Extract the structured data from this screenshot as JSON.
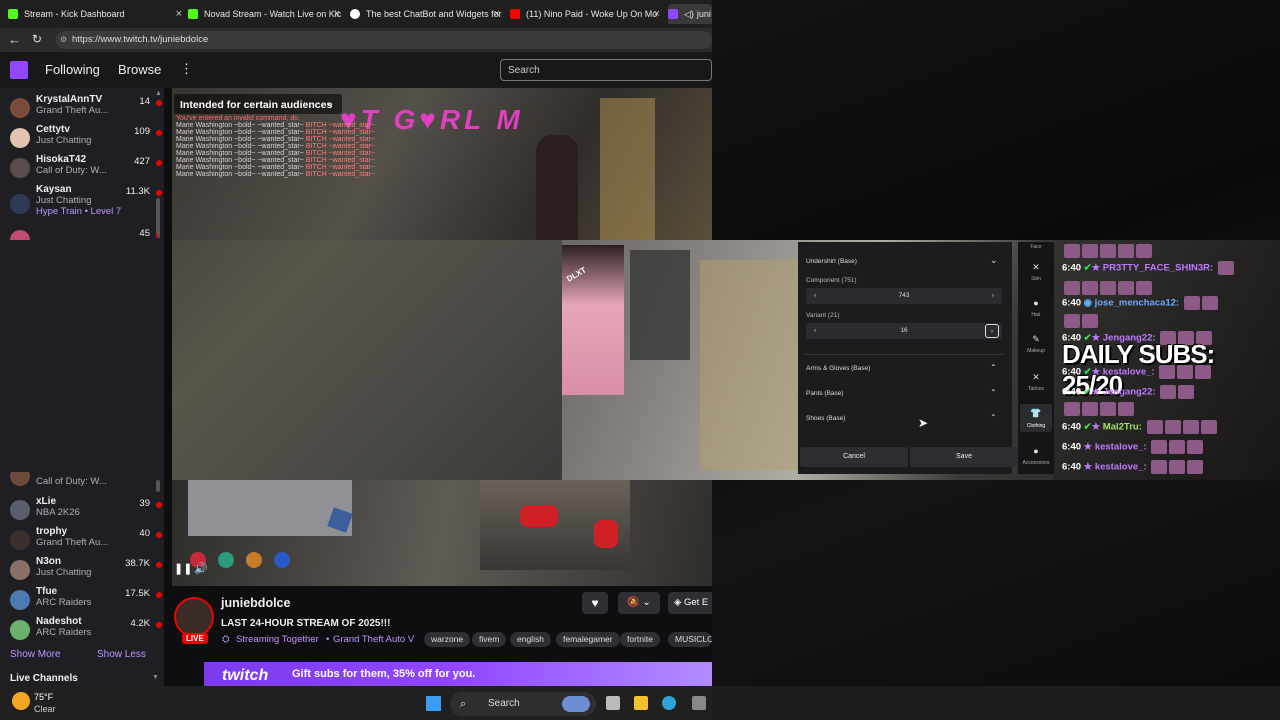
{
  "browser": {
    "tabs": [
      {
        "label": "Stream - Kick Dashboard",
        "color": "#53fc18"
      },
      {
        "label": "Novad Stream - Watch Live on Kic",
        "color": "#53fc18"
      },
      {
        "label": "The best ChatBot and Widgets for",
        "color": "#ffffff"
      },
      {
        "label": "(11) Nino Paid - Woke Up On Mo",
        "color": "#ff0000"
      },
      {
        "label": "juni",
        "color": "#9147ff"
      }
    ],
    "url": "https://www.twitch.tv/juniebdolce"
  },
  "twitch_nav": {
    "following": "Following",
    "browse": "Browse",
    "more": "⋮",
    "search_placeholder": "Search"
  },
  "sidebar": {
    "channels_top": [
      {
        "name": "KrystalAnnTV",
        "game": "Grand Theft Au...",
        "viewers": "14",
        "color": "#7a4a3a"
      },
      {
        "name": "Cettytv",
        "game": "Just Chatting",
        "viewers": "109",
        "color": "#e0c4b0"
      },
      {
        "name": "HisokaT42",
        "game": "Call of Duty: W...",
        "viewers": "427",
        "color": "#5a4c4a"
      },
      {
        "name": "Kaysan",
        "game": "Just Chatting",
        "viewers": "11.3K",
        "color": "#2e3b55",
        "extra": "Hype Train • Level 7"
      },
      {
        "name": "",
        "game": "",
        "viewers": "45",
        "color": "#c04a70"
      }
    ],
    "channels_bottom": [
      {
        "name": "",
        "game": "Call of Duty: W...",
        "viewers": "",
        "color": "#6a4a3a"
      },
      {
        "name": "xLie",
        "game": "NBA 2K26",
        "viewers": "39",
        "color": "#5a5f70"
      },
      {
        "name": "trophy",
        "game": "Grand Theft Au...",
        "viewers": "40",
        "color": "#3a2f2a"
      },
      {
        "name": "N3on",
        "game": "Just Chatting",
        "viewers": "38.7K",
        "color": "#8a7066"
      },
      {
        "name": "Tfue",
        "game": "ARC Raiders",
        "viewers": "17.5K",
        "color": "#4a7ab0"
      },
      {
        "name": "Nadeshot",
        "game": "ARC Raiders",
        "viewers": "4.2K",
        "color": "#6bb06b"
      }
    ],
    "show_more": "Show More",
    "show_less": "Show Less",
    "live_channels": "Live Channels"
  },
  "video": {
    "audience_label": "Intended for certain audiences",
    "stream_chat": {
      "notice": "You've entered an invalid command, do",
      "line_prefix": "Marie Washington ~bold~ ~wanted_star~",
      "line_suffix": "BITCH ~wanted_star~"
    }
  },
  "clothing_menu": {
    "undershirt": "Undershirt (Base)",
    "component_label": "Component (751)",
    "component_value": "743",
    "variant_label": "Variant (21)",
    "variant_value": "16",
    "arms": "Arms & Gloves (Base)",
    "pants": "Pants (Base)",
    "shoes": "Shoes (Base)",
    "cancel": "Cancel",
    "save": "Save",
    "categories": [
      "Face",
      "Skin",
      "Hair",
      "Makeup",
      "Tattoos",
      "Clothing",
      "Accessories"
    ]
  },
  "sub_chat": {
    "daily_subs": "DAILY SUBS: 25/20",
    "lines": [
      {
        "time": "6:40",
        "user": "PR3TTY_FACE_SHIN3R:"
      },
      {
        "time": "6:40",
        "user": "jose_menchaca12:"
      },
      {
        "time": "6:40",
        "user": "Jengang22:"
      },
      {
        "time": "6:40",
        "user": "kestalove_:"
      },
      {
        "time": "6:40",
        "user": "Jengang22:"
      },
      {
        "time": "6:40",
        "user": "Mal2Tru:"
      },
      {
        "time": "6:40",
        "user": "kestalove_:"
      },
      {
        "time": "6:40",
        "user": "kestalove_:"
      }
    ]
  },
  "stream_info": {
    "channel": "juniebdolce",
    "live_badge": "LIVE",
    "title": "LAST 24-HOUR STREAM OF 2025!!!",
    "streaming_together": "Streaming Together",
    "game": "Grand Theft Auto V",
    "tags": [
      "warzone",
      "fivem",
      "english",
      "femalegamer",
      "fortnite",
      "MUSICLO"
    ],
    "get_label": "Get E",
    "promo_logo": "twitch",
    "promo_text": "Gift subs for them, 35% off for you."
  },
  "taskbar": {
    "weather_temp": "75°F",
    "weather_desc": "Clear",
    "search": "Search"
  }
}
